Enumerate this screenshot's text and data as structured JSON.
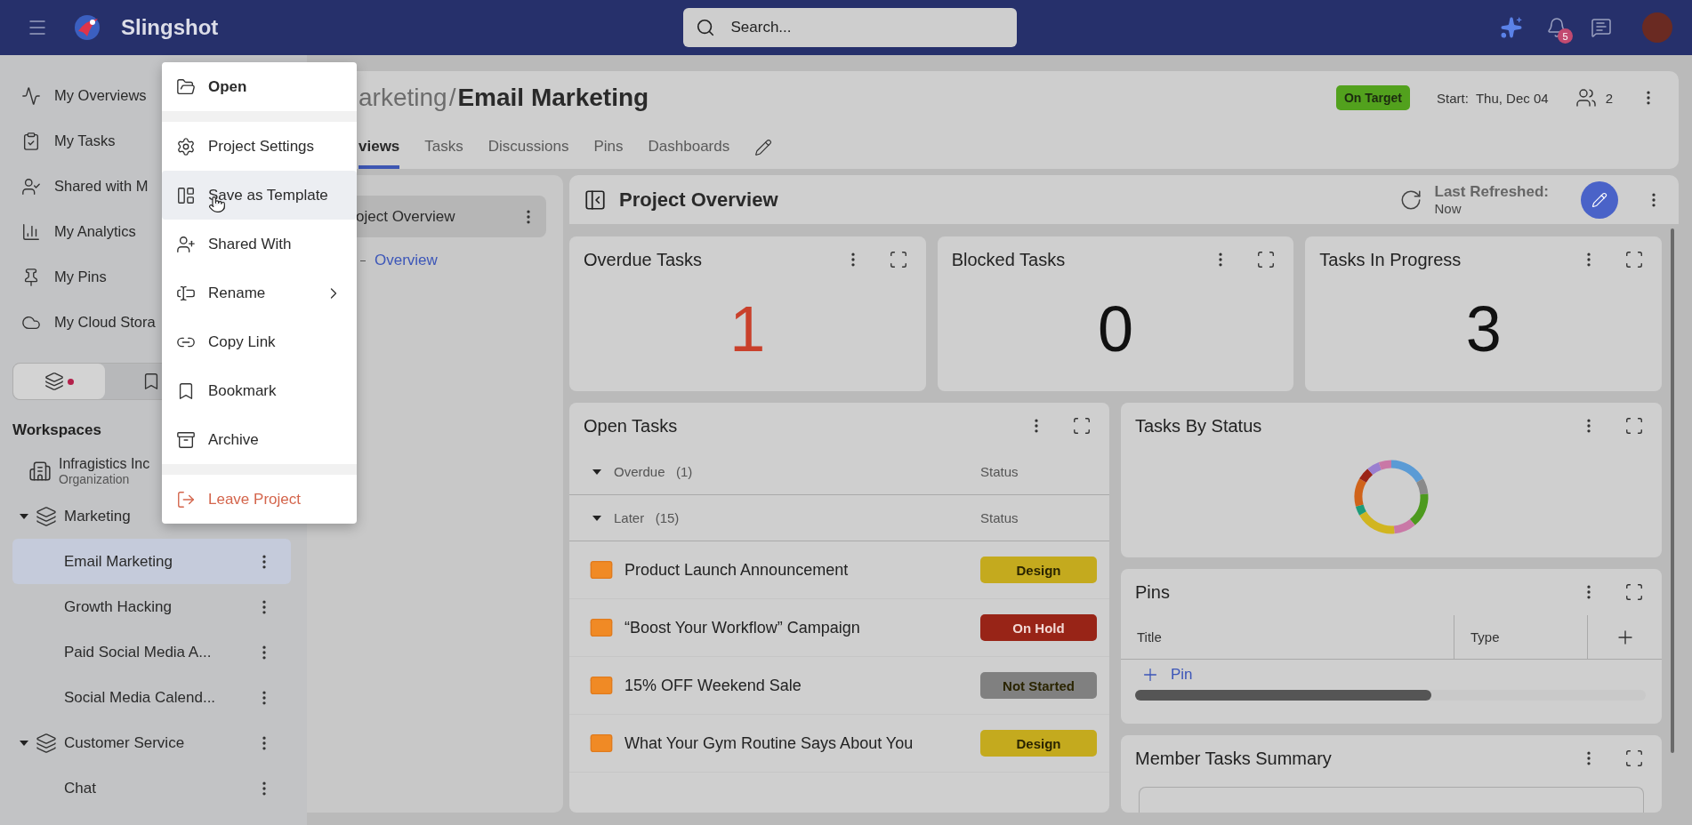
{
  "header": {
    "brand": "Slingshot",
    "search_placeholder": "Search...",
    "notification_count": "5"
  },
  "sidebar": {
    "nav": [
      {
        "label": "My Overviews"
      },
      {
        "label": "My Tasks"
      },
      {
        "label": "Shared with M"
      },
      {
        "label": "My Analytics"
      },
      {
        "label": "My Pins"
      },
      {
        "label": "My Cloud Stora"
      }
    ],
    "switcher": [
      {
        "selected": true,
        "dot": true
      },
      {
        "selected": false,
        "dot": false
      }
    ],
    "section_title": "Workspaces",
    "tree": [
      {
        "kind": "organization",
        "label": "Infragistics Inc",
        "sublabel": "Organization"
      },
      {
        "kind": "workspace",
        "label": "Marketing",
        "expanded": true,
        "kebab": false,
        "children": [
          {
            "kind": "project",
            "label": "Email Marketing",
            "selected": true,
            "kebab": true
          },
          {
            "kind": "project",
            "label": "Growth Hacking",
            "selected": false,
            "kebab": true
          },
          {
            "kind": "project",
            "label": "Paid Social Media A...",
            "selected": false,
            "kebab": true
          },
          {
            "kind": "project",
            "label": "Social Media Calend...",
            "selected": false,
            "kebab": true
          }
        ]
      },
      {
        "kind": "workspace",
        "label": "Customer Service",
        "expanded": true,
        "kebab": true,
        "children": [
          {
            "kind": "project",
            "label": "Chat",
            "selected": false,
            "kebab": true
          }
        ]
      }
    ]
  },
  "context_menu": {
    "items": [
      {
        "kind": "item",
        "label": "Open",
        "bold": true,
        "highlighted": false,
        "submenu": false
      },
      {
        "kind": "separator"
      },
      {
        "kind": "item",
        "label": "Project Settings",
        "bold": false,
        "highlighted": false,
        "submenu": false
      },
      {
        "kind": "item",
        "label": "Save as Template",
        "bold": false,
        "highlighted": true,
        "submenu": false
      },
      {
        "kind": "item",
        "label": "Shared With",
        "bold": false,
        "highlighted": false,
        "submenu": false
      },
      {
        "kind": "item",
        "label": "Rename",
        "bold": false,
        "highlighted": false,
        "submenu": true
      },
      {
        "kind": "item",
        "label": "Copy Link",
        "bold": false,
        "highlighted": false,
        "submenu": false
      },
      {
        "kind": "item",
        "label": "Bookmark",
        "bold": false,
        "highlighted": false,
        "submenu": false
      },
      {
        "kind": "item",
        "label": "Archive",
        "bold": false,
        "highlighted": false,
        "submenu": false
      },
      {
        "kind": "separator"
      },
      {
        "kind": "danger",
        "label": "Leave Project",
        "bold": false,
        "highlighted": false,
        "submenu": false
      }
    ]
  },
  "project": {
    "breadcrumb_parent": "arketing",
    "breadcrumb_separator": "/",
    "title": "Email Marketing",
    "tabs": [
      {
        "label": "views",
        "selected": true
      },
      {
        "label": "Tasks",
        "selected": false
      },
      {
        "label": "Discussions",
        "selected": false
      },
      {
        "label": "Pins",
        "selected": false
      },
      {
        "label": "Dashboards",
        "selected": false
      }
    ],
    "status": {
      "label": "On Target",
      "color": "#52a11d"
    },
    "start_label": "Start:",
    "start_date": "Thu, Dec 04",
    "members": "2"
  },
  "overview_nav": {
    "items": [
      {
        "label": "oject Overview",
        "selected": true
      }
    ],
    "links": [
      {
        "label": "Overview"
      }
    ]
  },
  "dashboard": {
    "title": "Project Overview",
    "refreshed_label": "Last Refreshed:",
    "refreshed_value": "Now",
    "kpis": [
      {
        "title": "Overdue Tasks",
        "value": "1",
        "alert": true
      },
      {
        "title": "Blocked Tasks",
        "value": "0",
        "alert": false
      },
      {
        "title": "Tasks In Progress",
        "value": "3",
        "alert": false
      }
    ],
    "open_tasks": {
      "title": "Open Tasks",
      "groups": [
        {
          "label": "Overdue",
          "count": "(1)",
          "status_header": "Status",
          "expanded": true
        },
        {
          "label": "Later",
          "count": "(15)",
          "status_header": "Status",
          "expanded": true,
          "rows": [
            {
              "title": "Product Launch Announcement",
              "status": "Design",
              "color": "#c4aa1e"
            },
            {
              "title": "“Boost Your Workflow” Campaign",
              "status": "On Hold",
              "color": "#982417"
            },
            {
              "title": "15% OFF Weekend Sale",
              "status": "Not Started",
              "color": "#808080"
            },
            {
              "title": "What Your Gym Routine Says About You",
              "status": "Design",
              "color": "#c4aa1e"
            }
          ]
        }
      ]
    },
    "tasks_by_status": {
      "title": "Tasks By Status"
    },
    "pins": {
      "title": "Pins",
      "columns": [
        "Title",
        "Type"
      ],
      "add_label": "Pin"
    },
    "member_summary": {
      "title": "Member Tasks Summary"
    }
  }
}
